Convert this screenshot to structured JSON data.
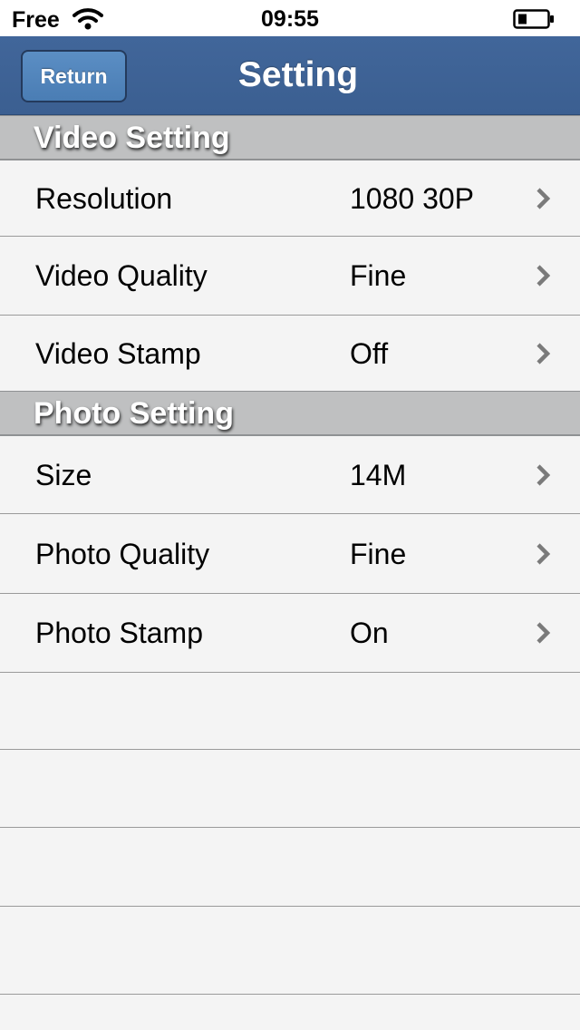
{
  "status_bar": {
    "carrier": "Free",
    "time": "09:55",
    "icons": [
      "wifi-icon",
      "battery-icon"
    ]
  },
  "nav": {
    "title": "Setting",
    "return_label": "Return"
  },
  "colors": {
    "nav_bar": "#3f6496",
    "return_button": "#5489c0",
    "section_header": "#bfc0c1",
    "background": "#f4f4f4"
  },
  "video_section": {
    "title": "Video Setting",
    "rows": [
      {
        "label": "Resolution",
        "value": "1080 30P"
      },
      {
        "label": "Video Quality",
        "value": "Fine"
      },
      {
        "label": "Video Stamp",
        "value": "Off"
      }
    ]
  },
  "photo_section": {
    "title": "Photo Setting",
    "rows": [
      {
        "label": "Size",
        "value": "14M"
      },
      {
        "label": "Photo Quality",
        "value": "Fine"
      },
      {
        "label": "Photo Stamp",
        "value": "On"
      }
    ]
  }
}
